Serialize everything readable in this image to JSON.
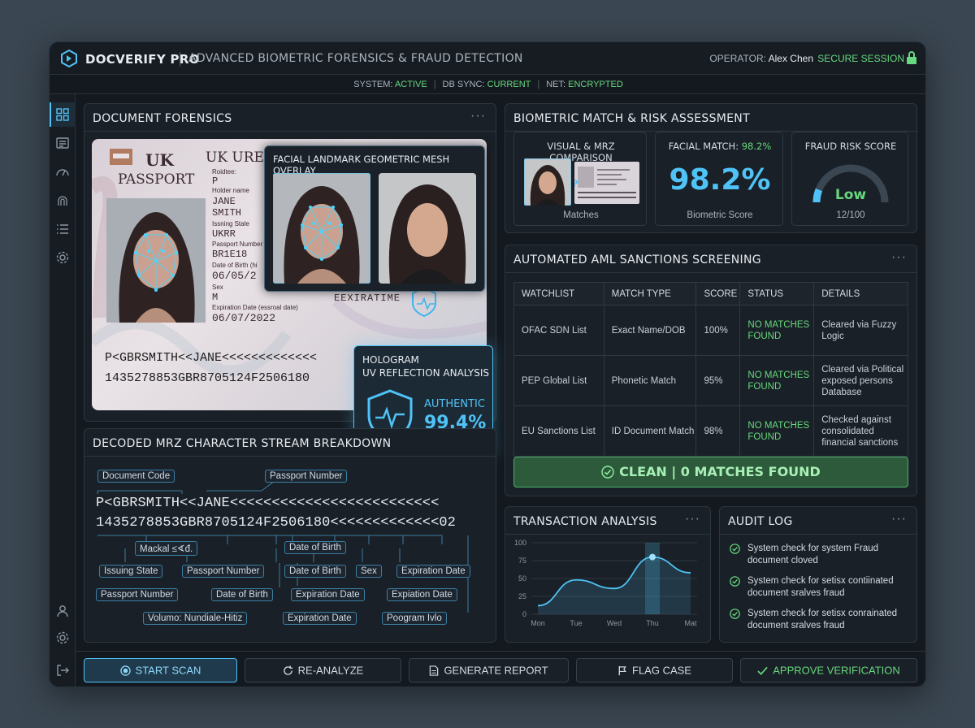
{
  "header": {
    "brand": "DOCVERIFY PRO",
    "subtitle": "ADVANCED BIOMETRIC FORENSICS & FRAUD DETECTION",
    "operator_label": "OPERATOR:",
    "operator_name": "Alex Chen",
    "session": "SECURE SESSION"
  },
  "status": {
    "system_label": "SYSTEM:",
    "system_value": "ACTIVE",
    "db_label": "DB SYNC:",
    "db_value": "CURRENT",
    "net_label": "NET:",
    "net_value": "ENCRYPTED"
  },
  "sidebar": {
    "items": [
      "dashboard-icon",
      "document-icon",
      "gauge-icon",
      "fingerprint-icon",
      "list-icon",
      "settings-icon",
      "user-icon",
      "settings-icon",
      "logout-icon"
    ]
  },
  "forensics": {
    "title": "DOCUMENT FORENSICS",
    "passport": {
      "country": "UK",
      "doc_word": "PASSPORT",
      "header_right": "UK URE",
      "field1_label": "Roidtee:",
      "field1_value": "P",
      "holder_label": "Holder name",
      "holder_first": "JANE",
      "holder_last": "SMITH",
      "state_label": "Issning Stale",
      "state_value": "UKRR",
      "passno_label": "Passport Number",
      "passno_value": "BR1E18",
      "dob_label": "Date of Birth (hi",
      "dob_value": "06/05/2",
      "sex_label": "Sex",
      "sex_value": "M",
      "exp_label": "Expiration Date (essroal date)",
      "exp_value": "06/07/2022",
      "exp_word": "EEXIRATIME",
      "mrz1": "P<GBRSMITH<<JANE<<<<<<<<<<<<<",
      "mrz2": "1435278853GBR8705124F2506180"
    },
    "mesh_title": "FACIAL LANDMARK GEOMETRIC MESH OVERLAY",
    "hologram": {
      "title": "HOLOGRAM",
      "subtitle": "UV REFLECTION ANALYSIS",
      "status": "AUTHENTIC",
      "score": "99.4%"
    }
  },
  "mrz_breakdown": {
    "title": "DECODED MRZ CHARACTER STREAM BREAKDOWN",
    "line1": "P<GBRSMITH<<JANE<<<<<<<<<<<<<<<<<<<<<<<<<",
    "line2": "1435278853GBR8705124F2506180<<<<<<<<<<<<<02",
    "tags_top": [
      "Document Code",
      "Passport Number"
    ],
    "tags": [
      "Mackal ≤∢đ.",
      "Date of Birth",
      "Issuing State",
      "Passport Number",
      "Date of Birth",
      "Sex",
      "Expiration Date",
      "Passport Number",
      "Date of Birth",
      "Expiration Date",
      "Expiation Date",
      "Volumo: Nundiale-Hitiz",
      "Expiration Date",
      "Poogram Ivlo"
    ]
  },
  "biometric": {
    "title": "BIOMETRIC MATCH & RISK ASSESSMENT",
    "visual_title": "VISUAL & MRZ COMPARISON",
    "visual_caption": "Matches",
    "facial_label": "FACIAL MATCH:",
    "facial_value": "98.2%",
    "big_score": "98.2%",
    "score_caption": "Biometric Score",
    "risk_title": "FRAUD RISK SCORE",
    "risk_level": "Low",
    "risk_value": "12/100",
    "risk_fraction": 0.12
  },
  "aml": {
    "title": "AUTOMATED AML SANCTIONS SCREENING",
    "columns": [
      "WATCHLIST",
      "MATCH TYPE",
      "SCORE",
      "STATUS",
      "DETAILS"
    ],
    "rows": [
      [
        "OFAC SDN List",
        "Exact Name/DOB",
        "100%",
        "NO MATCHES FOUND",
        "Cleared via Fuzzy Logic"
      ],
      [
        "PEP Global List",
        "Phonetic Match",
        "95%",
        "NO MATCHES FOUND",
        "Cleared via Political exposed persons Database"
      ],
      [
        "EU Sanctions List",
        "ID Document Match",
        "98%",
        "NO MATCHES FOUND",
        "Checked against consolidated financial sanctions"
      ]
    ],
    "result": "CLEAN | 0 MATCHES FOUND"
  },
  "transaction": {
    "title": "TRANSACTION ANALYSIS"
  },
  "chart_data": {
    "type": "area",
    "x": [
      "Mon",
      "Tue",
      "Wed",
      "Thu",
      "Mat"
    ],
    "values": [
      12,
      48,
      36,
      80,
      58
    ],
    "ylim": [
      0,
      100
    ],
    "yticks": [
      0,
      25,
      50,
      75,
      100
    ],
    "highlight": "Thu",
    "grid": true
  },
  "audit": {
    "title": "AUDIT LOG",
    "items": [
      [
        "System check for system Fraud",
        "document cloved"
      ],
      [
        "System check for setisx contiinated",
        "document sralves fraud"
      ],
      [
        "System check for setisx conrainated",
        "document sralves fraud"
      ]
    ]
  },
  "actions": {
    "start": "START SCAN",
    "reanalyze": "RE-ANALYZE",
    "report": "GENERATE REPORT",
    "flag": "FLAG CASE",
    "approve": "APPROVE VERIFICATION"
  },
  "colors": {
    "accent": "#4fc3f7",
    "success": "#67d97e",
    "bg": "#14191f"
  }
}
